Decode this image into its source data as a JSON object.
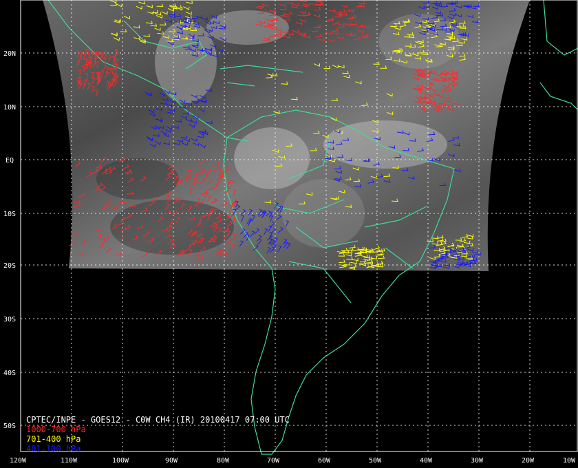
{
  "title": "CPTEC/INPE - GOES12 - C0W CH4 (IR) 20100417 07:00 UTC",
  "legend": [
    {
      "label": "1000-700 hPa",
      "color": "#ff2a2a"
    },
    {
      "label": "701-400 hPa",
      "color": "#ffff00"
    },
    {
      "label": "401-100 hPa",
      "color": "#1a1aff"
    }
  ],
  "lat_labels": [
    "20N",
    "10N",
    "EQ",
    "10S",
    "20S",
    "30S",
    "40S",
    "50S"
  ],
  "lon_labels": [
    "120W",
    "110W",
    "100W",
    "90W",
    "80W",
    "70W",
    "60W",
    "50W",
    "40W",
    "30W",
    "20W",
    "10W"
  ],
  "colors": {
    "coastline": "#3ddc97",
    "grid": "#ffffff",
    "background": "#000000"
  }
}
